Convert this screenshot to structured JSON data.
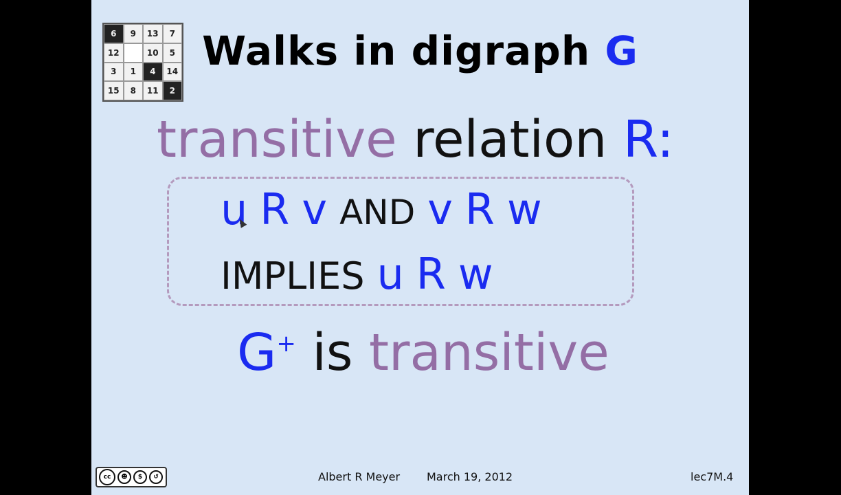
{
  "puzzle": {
    "tiles": [
      {
        "label": "6",
        "style": "dark"
      },
      {
        "label": "9",
        "style": "light"
      },
      {
        "label": "13",
        "style": "light"
      },
      {
        "label": "7",
        "style": "light"
      },
      {
        "label": "12",
        "style": "light"
      },
      {
        "label": "",
        "style": "blank"
      },
      {
        "label": "10",
        "style": "light"
      },
      {
        "label": "5",
        "style": "light"
      },
      {
        "label": "3",
        "style": "light"
      },
      {
        "label": "1",
        "style": "light"
      },
      {
        "label": "4",
        "style": "dark"
      },
      {
        "label": "14",
        "style": "light"
      },
      {
        "label": "15",
        "style": "light"
      },
      {
        "label": "8",
        "style": "light"
      },
      {
        "label": "11",
        "style": "light"
      },
      {
        "label": "2",
        "style": "dark"
      }
    ]
  },
  "title": {
    "text": "Walks in digraph ",
    "g": "G"
  },
  "definition": {
    "word1": "transitive",
    "word2": "relation",
    "r": "R:"
  },
  "rule": {
    "u1": "u",
    "r1": "R",
    "v1": "v",
    "and": "AND",
    "v2": "v",
    "r2": "R",
    "w1": "w",
    "implies": "IMPLIES",
    "u2": "u",
    "r3": "R",
    "w2": "w"
  },
  "conclusion": {
    "g": "G",
    "plus": "+",
    "is": "is",
    "transitive": "transitive"
  },
  "license": {
    "icons": [
      "cc-icon",
      "by-icon",
      "nc-icon",
      "sa-icon"
    ],
    "sub": "BY  NC  SA"
  },
  "footer": {
    "author": "Albert R Meyer",
    "date": "March 19, 2012",
    "id": "lec7M.4"
  },
  "colors": {
    "blue": "#1a2bf0",
    "purple": "#946ea5",
    "background": "#d8e6f6"
  }
}
